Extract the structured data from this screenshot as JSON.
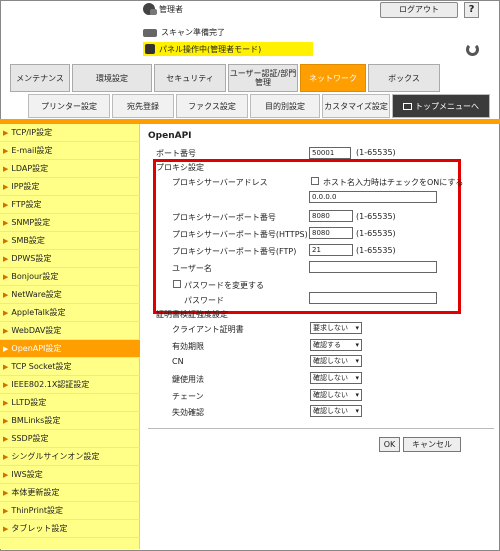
{
  "header": {
    "user": "管理者",
    "logout": "ログアウト",
    "help": "?",
    "scan_status": "スキャン準備完了",
    "panel_status": "パネル操作中(管理者モード)"
  },
  "main_tabs": [
    "メンテナンス",
    "環境設定",
    "セキュリティ",
    "ユーザー認証/部門管理",
    "ネットワーク",
    "ボックス"
  ],
  "sub_tabs": [
    "プリンター設定",
    "宛先登録",
    "ファクス設定",
    "目的別設定",
    "カスタマイズ設定",
    "トップメニューへ"
  ],
  "sidebar": [
    "TCP/IP設定",
    "E-mail設定",
    "LDAP設定",
    "IPP設定",
    "FTP設定",
    "SNMP設定",
    "SMB設定",
    "DPWS設定",
    "Bonjour設定",
    "NetWare設定",
    "AppleTalk設定",
    "WebDAV設定",
    "OpenAPI設定",
    "TCP Socket設定",
    "IEEE802.1X認証設定",
    "LLTD設定",
    "BMLinks設定",
    "SSDP設定",
    "シングルサインオン設定",
    "IWS設定",
    "本体更新設定",
    "ThinPrint設定",
    "タブレット設定"
  ],
  "form": {
    "section_title": "OpenAPI",
    "port_label": "ポート番号",
    "port_value": "50001",
    "port_range": "(1-65535)",
    "proxy_title": "プロキシ設定",
    "proxy_address_label": "プロキシサーバーアドレス",
    "host_input_note": "ホスト名入力時はチェックをONにする",
    "proxy_address_value": "0.0.0.0",
    "proxy_port_label": "プロキシサーバーポート番号",
    "proxy_port_value": "8080",
    "proxy_port_range": "(1-65535)",
    "proxy_https_label": "プロキシサーバーポート番号(HTTPS)",
    "proxy_https_value": "8080",
    "proxy_https_range": "(1-65535)",
    "proxy_ftp_label": "プロキシサーバーポート番号(FTP)",
    "proxy_ftp_value": "21",
    "proxy_ftp_range": "(1-65535)",
    "username_label": "ユーザー名",
    "change_password_label": "パスワードを変更する",
    "password_label": "パスワード",
    "cert_title": "証明書検証強度設定",
    "cert_rows": [
      {
        "label": "クライアント証明書",
        "value": "要求しない"
      },
      {
        "label": "有効期限",
        "value": "確認する"
      },
      {
        "label": "CN",
        "value": "確認しない"
      },
      {
        "label": "鍵使用法",
        "value": "確認しない"
      },
      {
        "label": "チェーン",
        "value": "確認しない"
      },
      {
        "label": "失効確認",
        "value": "確認しない"
      }
    ],
    "ok": "OK",
    "cancel": "キャンセル"
  },
  "colors": {
    "accent": "#ff9e00",
    "sidebar": "#ffff88",
    "highlight": "#e00000",
    "panel": "#fff100"
  }
}
